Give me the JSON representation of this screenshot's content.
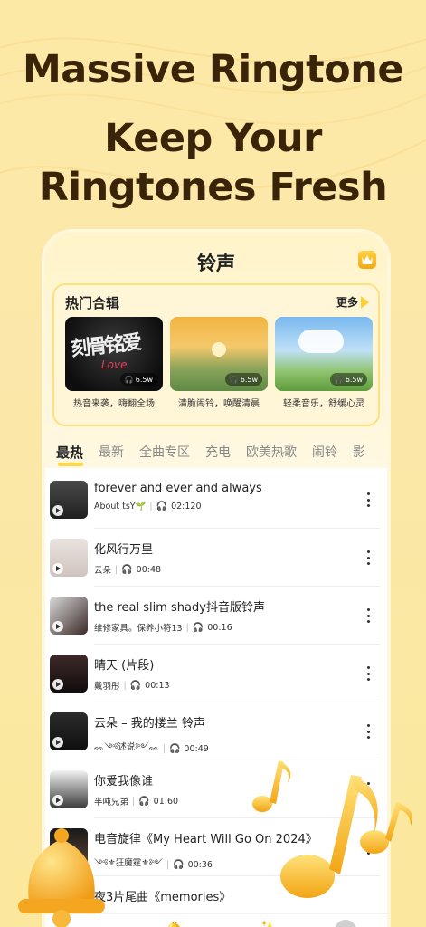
{
  "headline": {
    "line1": "Massive Ringtone",
    "line2": "Keep Your",
    "line3": "Ringtones Fresh"
  },
  "app": {
    "title": "铃声",
    "vip_label": "V"
  },
  "hot": {
    "title": "热门合辑",
    "more": "更多",
    "albums": [
      {
        "caption": "热音来袭，嗨翻全场",
        "count": "6.5w",
        "art": "刻骨铭爱",
        "art2": "Love"
      },
      {
        "caption": "清脆闹铃，唤醒清晨",
        "count": "6.5w"
      },
      {
        "caption": "轻柔音乐，舒缓心灵",
        "count": "6.5w"
      }
    ]
  },
  "tabs": [
    "最热",
    "最新",
    "全曲专区",
    "充电",
    "欧美热歌",
    "闹铃",
    "影"
  ],
  "songs": [
    {
      "title": "forever and ever and always",
      "artist": "About    tsY🌱",
      "duration": "02:120"
    },
    {
      "title": "化风行万里",
      "artist": "云朵",
      "duration": "00:48"
    },
    {
      "title": "the real slim shady抖音版铃声",
      "artist": "维修家具。保养小符13",
      "duration": "00:16"
    },
    {
      "title": "晴天 (片段)",
      "artist": "戴羽彤",
      "duration": "00:13"
    },
    {
      "title": "云朵 – 我的楼兰 铃声",
      "artist": "ᨐ༺述说༻ᨐ",
      "duration": "00:49"
    },
    {
      "title": "你爱我像谁",
      "artist": "半吨兄弟",
      "duration": "01:60"
    },
    {
      "title": "电音旋律《My Heart Will Go On 2024》",
      "artist": "༺⚜狂魔霆⚜༻",
      "duration": "00:36"
    },
    {
      "title": "夜3片尾曲《memories》",
      "artist": "",
      "duration": ""
    }
  ],
  "colors": {
    "accent": "#ffd84a",
    "headline": "#3a2409",
    "nav_active": "#f47c8a"
  },
  "icons": {
    "vip": "crown-icon",
    "more": "kebab-icon",
    "headset": "headset-icon",
    "nav": [
      "ringtone-bell-icon",
      "magic-sparkle-icon",
      "profile-icon"
    ]
  }
}
